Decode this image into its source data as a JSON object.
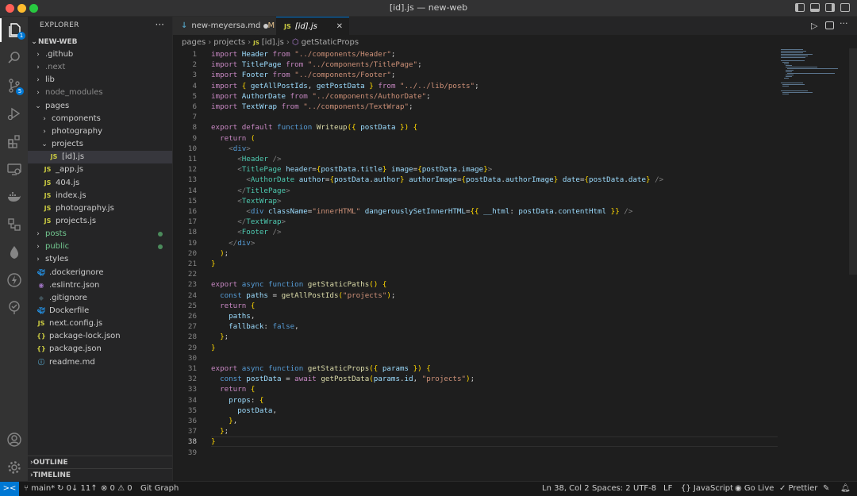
{
  "window": {
    "title": "[id].js — new-web"
  },
  "activity_bar": {
    "items": [
      "explorer-icon",
      "search-icon",
      "source-control-icon",
      "run-debug-icon",
      "extensions-icon",
      "remote-explorer-icon",
      "docker-icon",
      "database-icon",
      "mongodb-icon",
      "thunder-client-icon",
      "git-graph-icon"
    ],
    "explorer_badge": "1",
    "scm_badge": "5",
    "bottom": [
      "account-icon",
      "settings-gear-icon"
    ]
  },
  "sidebar": {
    "title": "EXPLORER",
    "more": "···",
    "root": "NEW-WEB",
    "tree": [
      {
        "label": ".github",
        "kind": "folder",
        "depth": 1,
        "open": false
      },
      {
        "label": ".next",
        "kind": "folder",
        "depth": 1,
        "open": false,
        "dim": true
      },
      {
        "label": "lib",
        "kind": "folder",
        "depth": 1,
        "open": false
      },
      {
        "label": "node_modules",
        "kind": "folder",
        "depth": 1,
        "open": false,
        "dim": true
      },
      {
        "label": "pages",
        "kind": "folder",
        "depth": 1,
        "open": true
      },
      {
        "label": "components",
        "kind": "folder",
        "depth": 2,
        "open": false
      },
      {
        "label": "photography",
        "kind": "folder",
        "depth": 2,
        "open": false
      },
      {
        "label": "projects",
        "kind": "folder",
        "depth": 2,
        "open": true
      },
      {
        "label": "[id].js",
        "kind": "js",
        "depth": 3,
        "selected": true
      },
      {
        "label": "_app.js",
        "kind": "js",
        "depth": 2
      },
      {
        "label": "404.js",
        "kind": "js",
        "depth": 2
      },
      {
        "label": "index.js",
        "kind": "js",
        "depth": 2
      },
      {
        "label": "photography.js",
        "kind": "js",
        "depth": 2
      },
      {
        "label": "projects.js",
        "kind": "js",
        "depth": 2
      },
      {
        "label": "posts",
        "kind": "folder",
        "depth": 1,
        "open": false,
        "modified": true,
        "color": "#73c991"
      },
      {
        "label": "public",
        "kind": "folder",
        "depth": 1,
        "open": false,
        "modified": true,
        "color": "#73c991"
      },
      {
        "label": "styles",
        "kind": "folder",
        "depth": 1,
        "open": false
      },
      {
        "label": ".dockerignore",
        "kind": "docker",
        "depth": 1
      },
      {
        "label": ".eslintrc.json",
        "kind": "eslint",
        "depth": 1
      },
      {
        "label": ".gitignore",
        "kind": "git",
        "depth": 1
      },
      {
        "label": "Dockerfile",
        "kind": "docker",
        "depth": 1
      },
      {
        "label": "next.config.js",
        "kind": "js",
        "depth": 1
      },
      {
        "label": "package-lock.json",
        "kind": "json",
        "depth": 1
      },
      {
        "label": "package.json",
        "kind": "json",
        "depth": 1
      },
      {
        "label": "readme.md",
        "kind": "md",
        "depth": 1
      }
    ],
    "sections": [
      "OUTLINE",
      "TIMELINE"
    ]
  },
  "tabs": [
    {
      "label": "new-meyersa.md",
      "suffix": "M",
      "icon": "markdown-icon"
    },
    {
      "label": "[id].js",
      "icon": "js-icon",
      "active": true
    }
  ],
  "breadcrumb": [
    "pages",
    "projects",
    "[id].js",
    "getStaticProps"
  ],
  "code": {
    "current_line": 38,
    "lines": [
      "import Header from \"../components/Header\";",
      "import TitlePage from \"../components/TitlePage\";",
      "import Footer from \"../components/Footer\";",
      "import { getAllPostIds, getPostData } from \"../../lib/posts\";",
      "import AuthorDate from \"../components/AuthorDate\";",
      "import TextWrap from \"../components/TextWrap\";",
      "",
      "export default function Writeup({ postData }) {",
      "  return (",
      "    <div>",
      "      <Header />",
      "      <TitlePage header={postData.title} image={postData.image}>",
      "        <AuthorDate author={postData.author} authorImage={postData.authorImage} date={postData.date} />",
      "      </TitlePage>",
      "      <TextWrap>",
      "        <div className=\"innerHTML\" dangerouslySetInnerHTML={{ __html: postData.contentHtml }} />",
      "      </TextWrap>",
      "      <Footer />",
      "    </div>",
      "  );",
      "}",
      "",
      "export async function getStaticPaths() {",
      "  const paths = getAllPostIds(\"projects\");",
      "  return {",
      "    paths,",
      "    fallback: false,",
      "  };",
      "}",
      "",
      "export async function getStaticProps({ params }) {",
      "  const postData = await getPostData(params.id, \"projects\");",
      "  return {",
      "    props: {",
      "      postData,",
      "    },",
      "  };",
      "}",
      ""
    ]
  },
  "statusbar": {
    "remote": "><",
    "branch": "main*",
    "sync": "0↓ 11↑",
    "problems": "⊗ 0 ⚠ 0",
    "git_graph": "Git Graph",
    "cursor": "Ln 38, Col 2",
    "spaces": "Spaces: 2",
    "encoding": "UTF-8",
    "eol": "LF",
    "language": "{} JavaScript",
    "go_live": "Go Live",
    "prettier": "✓ Prettier"
  }
}
